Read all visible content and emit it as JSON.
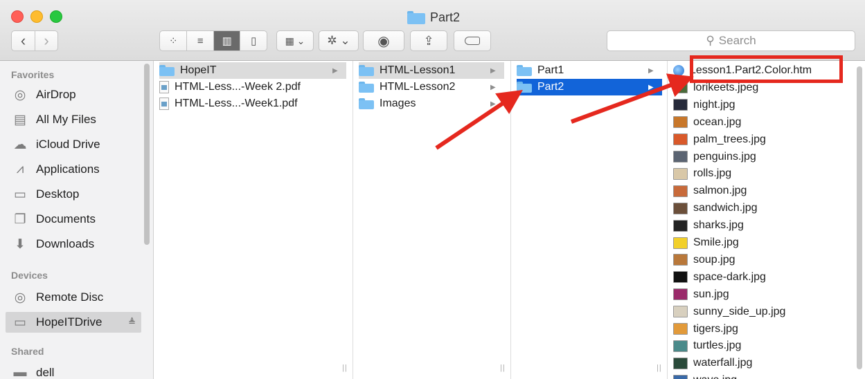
{
  "window": {
    "title": "Part2"
  },
  "toolbar": {
    "back_glyph": "‹",
    "forward_glyph": "›",
    "view_icons": "⁘",
    "view_list": "≡",
    "view_columns": "▥",
    "view_coverflow": "▯",
    "arrange_glyph": "▦ ⌄",
    "action_glyph": "✲ ⌄",
    "quicklook_glyph": "◉",
    "share_glyph": "⇪",
    "search_icon_glyph": "⚲",
    "search_placeholder": "Search"
  },
  "sidebar": {
    "favorites_label": "Favorites",
    "favorites": [
      {
        "label": "AirDrop",
        "icon": "airdrop-icon",
        "glyph": "◎"
      },
      {
        "label": "All My Files",
        "icon": "all-files-icon",
        "glyph": "▤"
      },
      {
        "label": "iCloud Drive",
        "icon": "cloud-icon",
        "glyph": "☁"
      },
      {
        "label": "Applications",
        "icon": "applications-icon",
        "glyph": "⩘"
      },
      {
        "label": "Desktop",
        "icon": "desktop-icon",
        "glyph": "▭"
      },
      {
        "label": "Documents",
        "icon": "documents-icon",
        "glyph": "❐"
      },
      {
        "label": "Downloads",
        "icon": "downloads-icon",
        "glyph": "⬇"
      }
    ],
    "devices_label": "Devices",
    "devices": [
      {
        "label": "Remote Disc",
        "icon": "remote-disc-icon",
        "glyph": "◎"
      },
      {
        "label": "HopeITDrive",
        "icon": "drive-icon",
        "glyph": "▭",
        "eject": "≜",
        "selected": true
      }
    ],
    "shared_label": "Shared",
    "shared": [
      {
        "label": "dell",
        "icon": "computer-icon",
        "glyph": "▬"
      }
    ]
  },
  "columns": {
    "col1": [
      {
        "label": "HopeIT",
        "type": "folder"
      },
      {
        "label": "HTML-Less...-Week 2.pdf",
        "type": "pdf"
      },
      {
        "label": "HTML-Less...-Week1.pdf",
        "type": "pdf"
      }
    ],
    "col2": [
      {
        "label": "HTML-Lesson1",
        "type": "folder"
      },
      {
        "label": "HTML-Lesson2",
        "type": "folder"
      },
      {
        "label": "Images",
        "type": "folder"
      }
    ],
    "col3": [
      {
        "label": "Part1",
        "type": "folder"
      },
      {
        "label": "Part2",
        "type": "folder"
      }
    ],
    "col4": [
      {
        "label": "Lesson1.Part2.Color.htm",
        "color": "#2a78d6"
      },
      {
        "label": "lorikeets.jpeg",
        "color": "#4a6b3a"
      },
      {
        "label": "night.jpg",
        "color": "#262a3a"
      },
      {
        "label": "ocean.jpg",
        "color": "#c8772a"
      },
      {
        "label": "palm_trees.jpg",
        "color": "#d9592a"
      },
      {
        "label": "penguins.jpg",
        "color": "#5b6472"
      },
      {
        "label": "rolls.jpg",
        "color": "#d9c8a8"
      },
      {
        "label": "salmon.jpg",
        "color": "#c86a3a"
      },
      {
        "label": "sandwich.jpg",
        "color": "#6b4f3a"
      },
      {
        "label": "sharks.jpg",
        "color": "#222222"
      },
      {
        "label": "Smile.jpg",
        "color": "#f2d02a"
      },
      {
        "label": "soup.jpg",
        "color": "#b9783a"
      },
      {
        "label": "space-dark.jpg",
        "color": "#111111"
      },
      {
        "label": "sun.jpg",
        "color": "#9a2a6a"
      },
      {
        "label": "sunny_side_up.jpg",
        "color": "#d8d0bf"
      },
      {
        "label": "tigers.jpg",
        "color": "#e29a3a"
      },
      {
        "label": "turtles.jpg",
        "color": "#4a8a8a"
      },
      {
        "label": "waterfall.jpg",
        "color": "#2a4a3a"
      },
      {
        "label": "wave.jpg",
        "color": "#3a6aa8"
      }
    ]
  },
  "grip_glyph": "||",
  "chevron_glyph": "▶",
  "colors": {
    "accent": "#1264d9",
    "annotation": "#e5281e"
  }
}
